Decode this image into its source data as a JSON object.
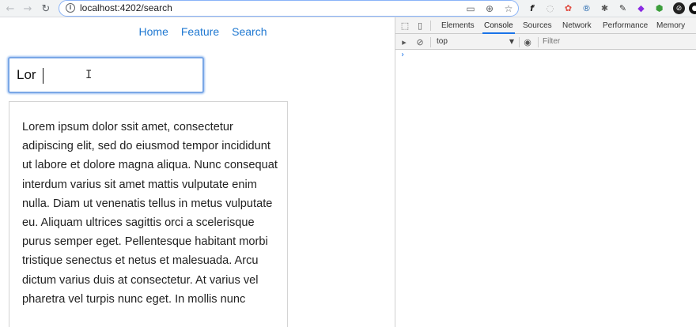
{
  "browser": {
    "url": "localhost:4202/search",
    "back_icon": "arrow-left-icon",
    "forward_icon": "arrow-right-icon",
    "reload_icon": "reload-icon"
  },
  "page": {
    "nav": [
      {
        "label": "Home"
      },
      {
        "label": "Feature"
      },
      {
        "label": "Search"
      }
    ],
    "search": {
      "value": "Lor"
    },
    "card_text": "Lorem ipsum dolor ssit amet, consectetur adipiscing elit, sed do eiusmod tempor incididunt ut labore et dolore magna aliqua. Nunc consequat interdum varius sit amet mattis vulputate enim nulla. Diam ut venenatis tellus in metus vulputate eu. Aliquam ultrices sagittis orci a scelerisque purus semper eget. Pellentesque habitant morbi tristique senectus et netus et malesuada. Arcu dictum varius duis at consectetur. At varius vel pharetra vel turpis nunc eget. In mollis nunc"
  },
  "devtools": {
    "tabs": [
      {
        "label": "Elements"
      },
      {
        "label": "Console"
      },
      {
        "label": "Sources"
      },
      {
        "label": "Network"
      },
      {
        "label": "Performance"
      },
      {
        "label": "Memory"
      }
    ],
    "active_tab": "Console",
    "context": "top",
    "filter_placeholder": "Filter",
    "prompt": "›"
  },
  "colors": {
    "link": "#1f78d1",
    "focus_border": "#7aa7e6",
    "devtools_active": "#1a73e8"
  }
}
